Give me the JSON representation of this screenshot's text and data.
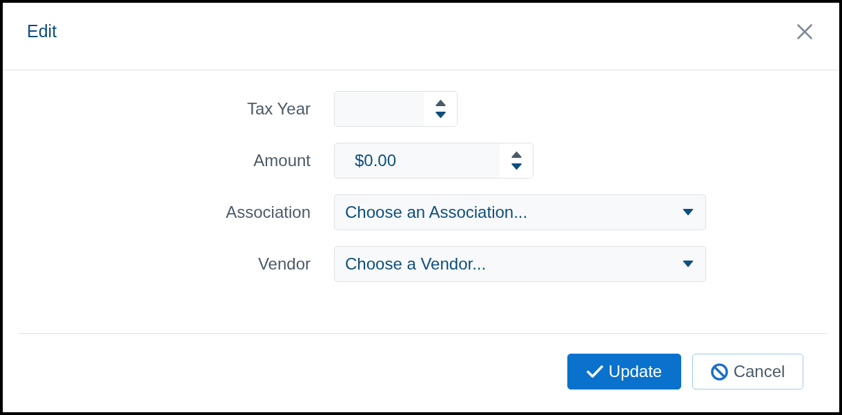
{
  "dialog": {
    "title": "Edit"
  },
  "fields": [
    {
      "kind": "year",
      "label": "Tax Year"
    },
    {
      "kind": "money",
      "label": "Amount",
      "value": "$0.00"
    },
    {
      "kind": "select",
      "label": "Association",
      "placeholder": "Choose an Association..."
    },
    {
      "kind": "select",
      "label": "Vendor",
      "placeholder": "Choose a Vendor..."
    }
  ],
  "buttons": [
    {
      "kind": "primary",
      "label": "Update"
    },
    {
      "kind": "secondary",
      "label": "Cancel"
    }
  ]
}
